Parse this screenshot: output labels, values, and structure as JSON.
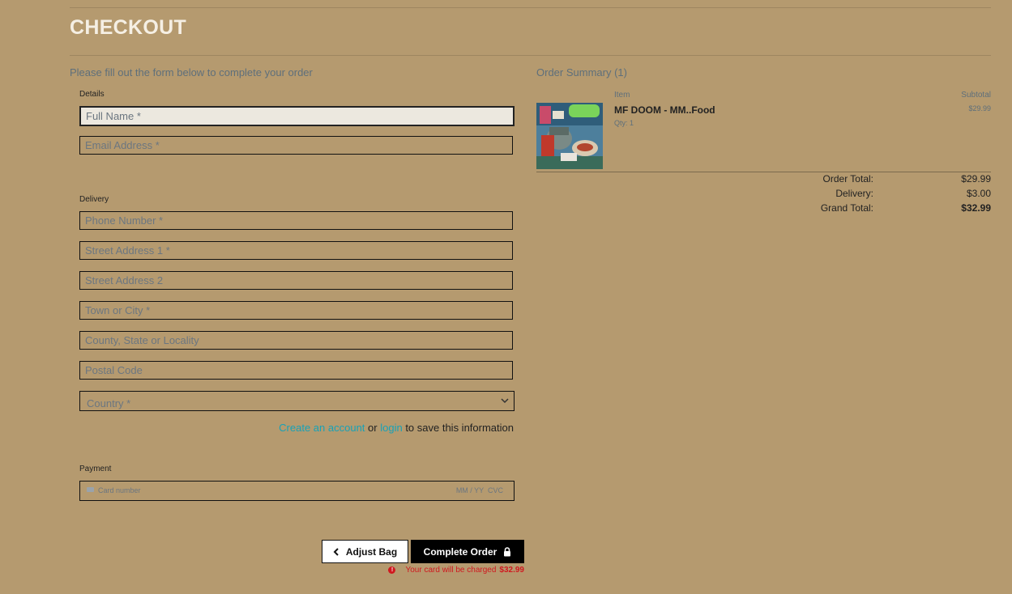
{
  "page": {
    "title": "CHECKOUT",
    "intro": "Please fill out the form below to complete your order"
  },
  "details": {
    "label": "Details",
    "full_name_placeholder": "Full Name *",
    "email_placeholder": "Email Address *"
  },
  "delivery": {
    "label": "Delivery",
    "phone_placeholder": "Phone Number *",
    "street1_placeholder": "Street Address 1 *",
    "street2_placeholder": "Street Address 2",
    "town_placeholder": "Town or City *",
    "county_placeholder": "County, State or Locality",
    "postcode_placeholder": "Postal Code",
    "country_placeholder": "Country *",
    "create_account": "Create an account",
    "or": "or",
    "login": "login",
    "save_suffix": "to save this information"
  },
  "payment": {
    "label": "Payment",
    "card_placeholder": "Card number",
    "expiry_cvc": "MM / YY  CVC"
  },
  "actions": {
    "adjust_label": "Adjust Bag",
    "complete_label": "Complete Order",
    "charge_text": "Your card will be charged",
    "charge_amount": "$32.99"
  },
  "summary": {
    "title": "Order Summary (1)",
    "item_header": "Item",
    "subtotal_header": "Subtotal",
    "items": [
      {
        "name": "MF DOOM - MM..Food",
        "qty": "Qty: 1",
        "subtotal": "$29.99"
      }
    ],
    "order_total_label": "Order Total:",
    "order_total": "$29.99",
    "delivery_label": "Delivery:",
    "delivery_total": "$3.00",
    "grand_total_label": "Grand Total:",
    "grand_total": "$32.99"
  },
  "icons": {
    "chevron_left": "chevron-left-icon",
    "lock": "lock-icon",
    "error": "exclamation-circle-icon",
    "card": "credit-card-icon",
    "select": "chevron-down-icon"
  },
  "colors": {
    "background": "#b59a6f",
    "link": "#17a2b8",
    "error": "#d0181f",
    "primary_button": "#000000"
  }
}
